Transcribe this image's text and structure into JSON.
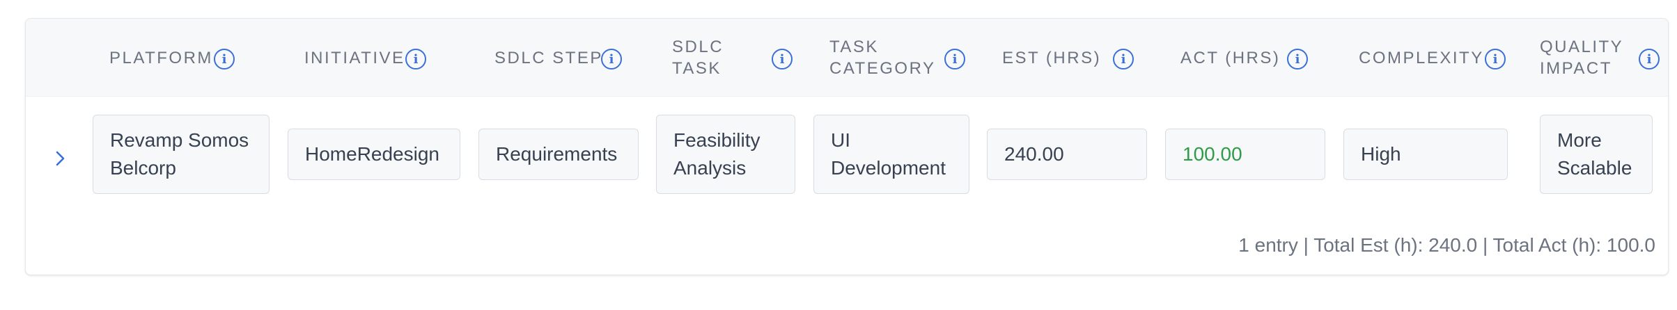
{
  "table": {
    "columns": [
      {
        "label": "PLATFORM"
      },
      {
        "label": "INITIATIVE"
      },
      {
        "label": "SDLC STEP"
      },
      {
        "label": "SDLC TASK"
      },
      {
        "label": "TASK CATEGORY"
      },
      {
        "label": "EST (HRS)"
      },
      {
        "label": "ACT (HRS)"
      },
      {
        "label": "COMPLEXITY"
      },
      {
        "label": "QUALITY IMPACT"
      }
    ],
    "info_icon": "info-icon",
    "expand_icon": "chevron-right-icon",
    "rows": [
      {
        "platform": "Revamp Somos Belcorp",
        "initiative": "HomeRedesign",
        "sdlc_step": "Requirements",
        "sdlc_task": "Feasibility Analysis",
        "task_category": "UI Development",
        "est_hrs": "240.00",
        "act_hrs": "100.00",
        "complexity": "High",
        "quality_impact": "More Scalable"
      }
    ],
    "footer": "1 entry | Total Est (h): 240.0 | Total Act (h): 100.0"
  },
  "colors": {
    "accent": "#3b6fd8",
    "actual_hours": "#2f9b47",
    "header_bg": "#f7f8fa"
  }
}
